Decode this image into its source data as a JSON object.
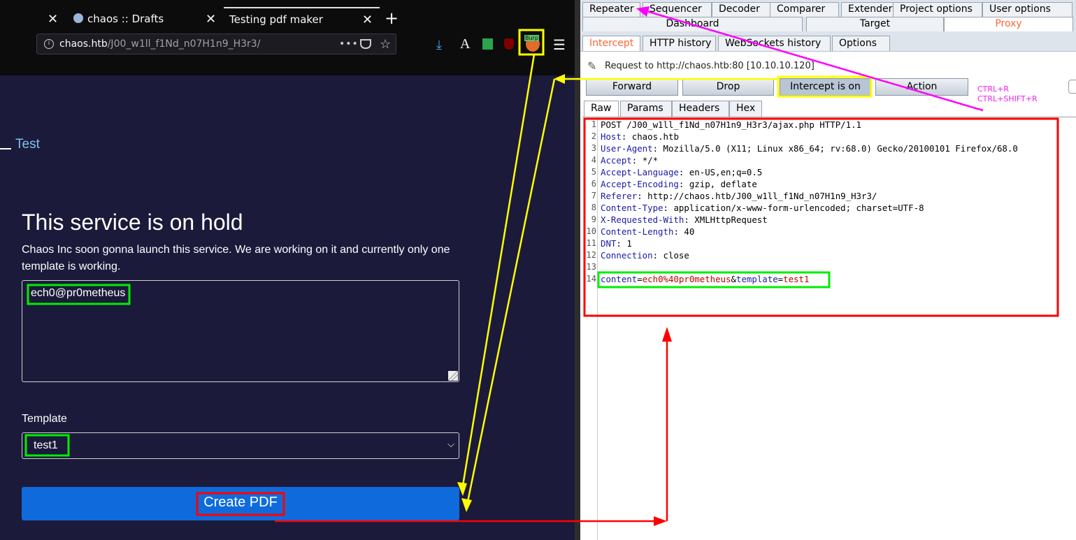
{
  "browser": {
    "tabs": [
      {
        "label": "chaos :: Drafts"
      },
      {
        "label": "Testing pdf maker"
      }
    ],
    "url_host": "chaos.htb",
    "url_path": "/J00_w1ll_f1Nd_n07H1n9_H3r3/",
    "burp_badge": "Burp",
    "toolbar_letter": "A"
  },
  "page": {
    "nav_link": "Test",
    "title": "This service is on hold",
    "description": "Chaos Inc soon gonna launch this service. We are working on it and currently only one template is working.",
    "textarea_value": "ech0@pr0metheus",
    "template_label": "Template",
    "template_selected": "test1",
    "create_button": "Create PDF"
  },
  "burp": {
    "main_tabs": [
      "Repeater",
      "Sequencer",
      "Decoder",
      "Comparer",
      "Extender",
      "Project options",
      "User options",
      "Dashboard",
      "Target",
      "Proxy"
    ],
    "proxy_tabs": [
      "Intercept",
      "HTTP history",
      "WebSockets history",
      "Options"
    ],
    "request_to": "Request to http://chaos.htb:80  [10.10.10.120]",
    "buttons": {
      "forward": "Forward",
      "drop": "Drop",
      "intercept": "Intercept is on",
      "action": "Action"
    },
    "hints": {
      "repeat": "CTRL+R",
      "repeat_shift": "CTRL+SHIFT+R"
    },
    "editor_tabs": [
      "Raw",
      "Params",
      "Headers",
      "Hex"
    ],
    "request_line": "POST /J00_w1ll_f1Nd_n07H1n9_H3r3/ajax.php HTTP/1.1",
    "headers": [
      {
        "name": "Host",
        "value": "chaos.htb"
      },
      {
        "name": "User-Agent",
        "value": "Mozilla/5.0 (X11; Linux x86_64; rv:68.0) Gecko/20100101 Firefox/68.0"
      },
      {
        "name": "Accept",
        "value": "*/*"
      },
      {
        "name": "Accept-Language",
        "value": "en-US,en;q=0.5"
      },
      {
        "name": "Accept-Encoding",
        "value": "gzip, deflate"
      },
      {
        "name": "Referer",
        "value": "http://chaos.htb/J00_w1ll_f1Nd_n07H1n9_H3r3/"
      },
      {
        "name": "Content-Type",
        "value": "application/x-www-form-urlencoded; charset=UTF-8"
      },
      {
        "name": "X-Requested-With",
        "value": "XMLHttpRequest"
      },
      {
        "name": "Content-Length",
        "value": "40"
      },
      {
        "name": "DNT",
        "value": "1"
      },
      {
        "name": "Connection",
        "value": "close"
      }
    ],
    "body": {
      "p1": "content",
      "v1": "ech0%40pr0metheus",
      "p2": "template",
      "v2": "test1"
    },
    "line_numbers": [
      "1",
      "2",
      "3",
      "4",
      "5",
      "6",
      "7",
      "8",
      "9",
      "10",
      "11",
      "12",
      "13",
      "14"
    ]
  },
  "colors": {
    "annot_yellow": "#ffff00",
    "annot_green": "#00ff00",
    "annot_red": "#ff0000",
    "annot_magenta": "#ff00ff",
    "proxy_accent": "#ff6633"
  }
}
